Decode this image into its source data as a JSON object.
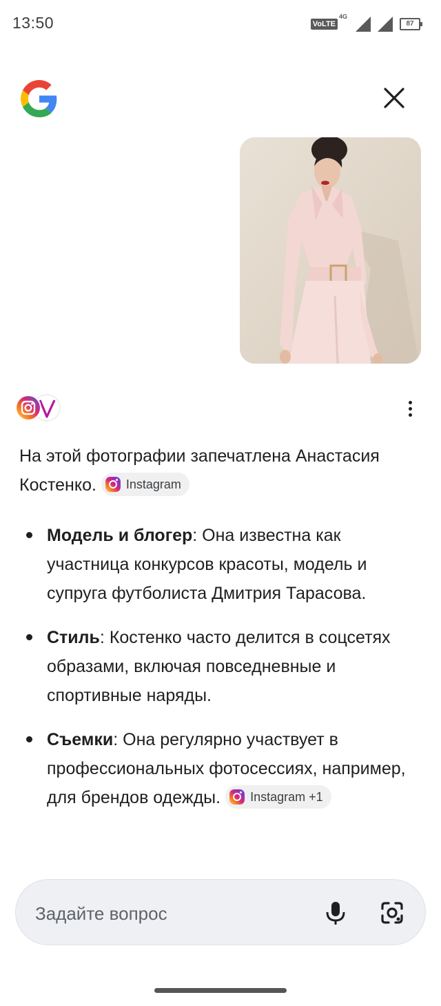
{
  "status_bar": {
    "time": "13:50",
    "network": "VoLTE",
    "network_gen": "4G",
    "battery": "87"
  },
  "header": {
    "logo": "google-logo",
    "close_icon": "close-icon"
  },
  "answer": {
    "intro": "На этой фотографии запечатлена Анастасия Костенко.",
    "intro_source": "Instagram",
    "bullets": [
      {
        "title": "Модель и блогер",
        "text": ": Она известна как участница конкурсов красоты, модель и супруга футболиста Дмитрия Тарасова.",
        "source": ""
      },
      {
        "title": "Стиль",
        "text": ": Костенко часто делится в соцсетях образами, включая повседневные и спортивные наряды.",
        "source": ""
      },
      {
        "title": "Съемки",
        "text": ": Она регулярно участвует в профессиональных фотосессиях, например, для брендов одежды.",
        "source": "Instagram +1"
      }
    ]
  },
  "ask_bar": {
    "placeholder": "Задайте вопрос",
    "mic_icon": "mic-icon",
    "lens_icon": "lens-icon"
  },
  "colors": {
    "google_blue": "#4285F4",
    "google_red": "#EA4335",
    "google_yellow": "#FBBC05",
    "google_green": "#34A853"
  }
}
